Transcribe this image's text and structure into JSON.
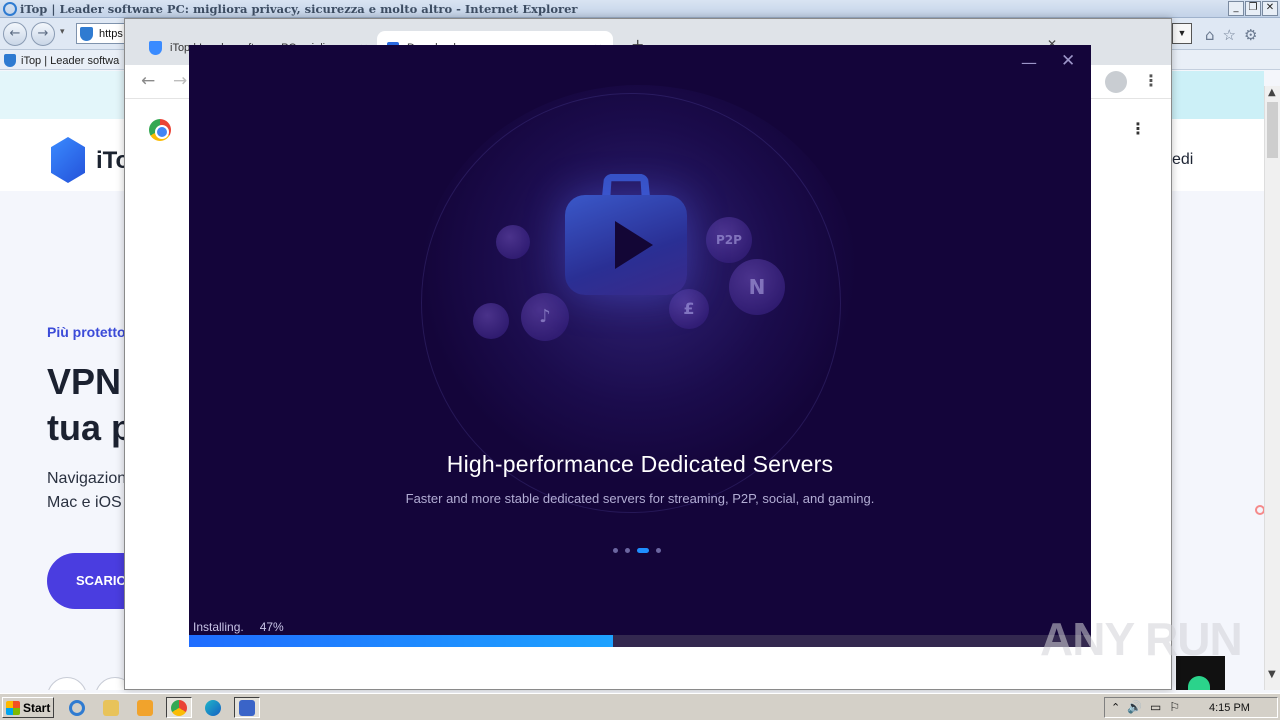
{
  "ie_window": {
    "title": "iTop | Leader software PC: migliora privacy, sicurezza e molto altro - Internet Explorer",
    "address_text": "https",
    "tab_label": "iTop | Leader softwa",
    "window_buttons": [
      "_",
      "❐",
      "✕"
    ],
    "back_glyph": "←",
    "forward_glyph": "→",
    "dropdown_glyph": "▾",
    "address_dropdown_glyph": "▼",
    "right_icons": [
      "⌂",
      "☆",
      "⚙"
    ]
  },
  "webpage": {
    "logo_text": "iTo",
    "nav_right_text": "edi",
    "kicker": "Più protetto",
    "headline_line1": "VPN",
    "headline_line2": "tua p",
    "desc_line1": "Navigazion",
    "desc_line2": "Mac e iOS",
    "cta_label": "SCARICA"
  },
  "chrome_window": {
    "tab1_label": "iTop | Leader software PC: migliora",
    "tab2_label": "Downloads",
    "tab_close_glyph": "✕",
    "new_tab_glyph": "+",
    "back_glyph": "←",
    "forward_glyph": "→",
    "menu_glyph": "⋮"
  },
  "installer": {
    "minimize_glyph": "—",
    "close_glyph": "✕",
    "headline": "High-performance Dedicated Servers",
    "subtitle": "Faster and more stable dedicated servers for streaming, P2P, social, and gaming.",
    "bubble_labels": [
      "P2P",
      "N",
      "♪",
      "£"
    ],
    "carousel_total": 4,
    "carousel_active": 3,
    "status_label": "Installing.",
    "progress_text": "47%",
    "progress_fraction": 0.47,
    "colors": {
      "background": "#14053a",
      "progress": "#1f8fff",
      "track": "#33284f"
    }
  },
  "watermark": "ANY RUN",
  "taskbar": {
    "start_label": "Start",
    "apps": [
      "internet-explorer",
      "file-explorer",
      "media-player",
      "chrome",
      "edge",
      "installer"
    ],
    "tray_arrow": "⌃",
    "tray_icons": [
      "🔊",
      "▭",
      "⚐"
    ],
    "clock": "4:15 PM"
  }
}
